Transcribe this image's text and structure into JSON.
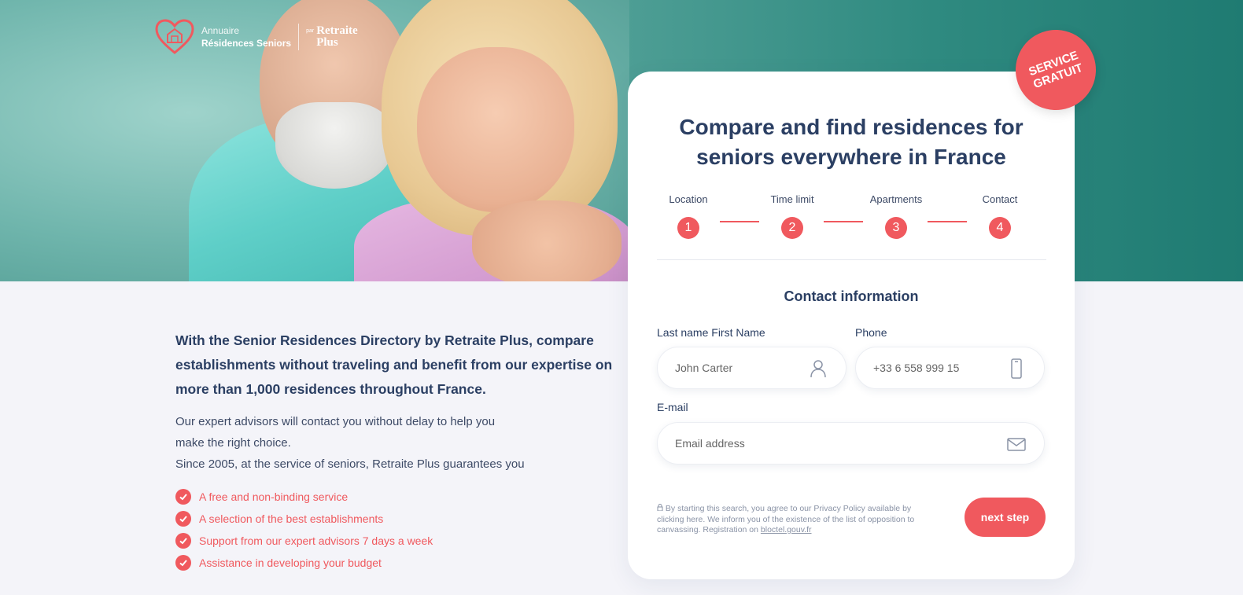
{
  "brand": {
    "line1": "Annuaire",
    "line2": "Résidences Seniors",
    "par": "par",
    "partner_line1": "Retraite",
    "partner_line2": "Plus",
    "accent_color": "#f0595e",
    "hero_color": "#2f8a80"
  },
  "hero": {
    "image_alt": "Smiling senior couple embracing"
  },
  "badge": {
    "line1": "SERVICE",
    "line2": "GRATUIT"
  },
  "intro": {
    "lead": "With the Senior Residences Directory by Retraite Plus, compare establishments without traveling and benefit from our expertise on more than 1,000 residences throughout France.",
    "body_line1": "Our expert advisors will contact you without delay to help you",
    "body_line2": "make the right choice.",
    "body_line3": "Since 2005, at the service of seniors, Retraite Plus guarantees you",
    "benefits": [
      "A free and non-binding service",
      "A selection of the best establishments",
      "Support from our expert advisors 7 days a week",
      "Assistance in developing your budget"
    ]
  },
  "form": {
    "title_line1": "Compare and find residences for",
    "title_line2": "seniors everywhere in France",
    "steps": [
      {
        "label": "Location",
        "num": "1"
      },
      {
        "label": "Time limit",
        "num": "2"
      },
      {
        "label": "Apartments",
        "num": "3"
      },
      {
        "label": "Contact",
        "num": "4"
      }
    ],
    "section_title": "Contact information",
    "name_label": "Last name First Name",
    "name_placeholder": "John Carter",
    "phone_label": "Phone",
    "phone_placeholder": "+33 6 558 999 15",
    "email_label": "E-mail",
    "email_placeholder": "Email address",
    "legal_text": "By starting this search, you agree to our Privacy Policy available by clicking here. We inform you of the existence of the list of opposition to canvassing. Registration on",
    "legal_link": "bloctel.gouv.fr",
    "next_label": "next step"
  }
}
